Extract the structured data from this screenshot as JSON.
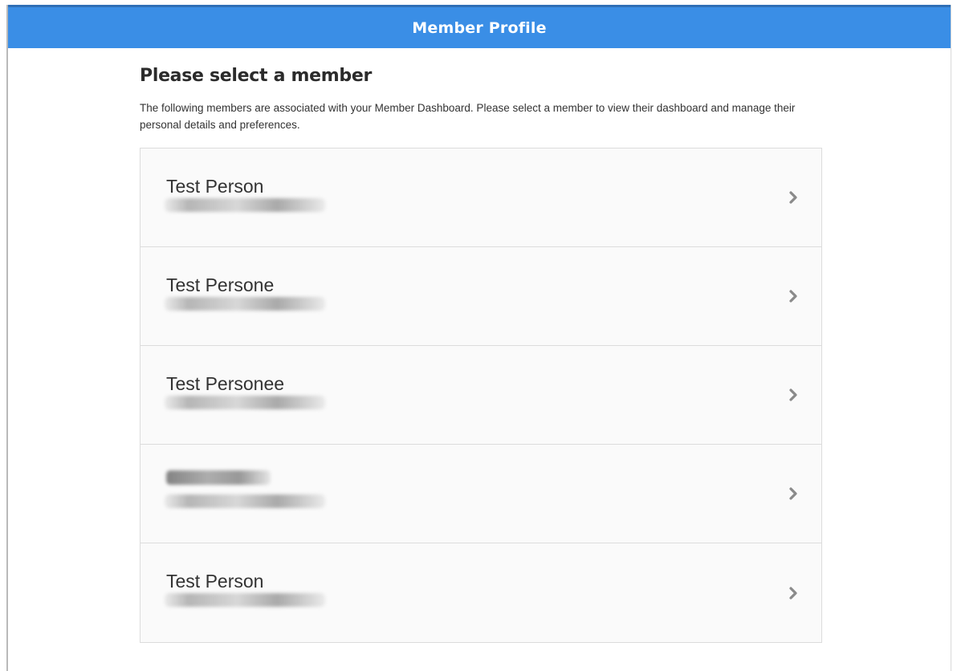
{
  "header": {
    "title": "Member Profile"
  },
  "main": {
    "heading": "Please select a member",
    "intro": "The following members are associated with your Member Dashboard. Please select a member to view their dashboard and manage their personal details and preferences."
  },
  "members": [
    {
      "name": "Test Person",
      "name_redacted": false,
      "detail_redacted": true
    },
    {
      "name": "Test Persone",
      "name_redacted": false,
      "detail_redacted": true
    },
    {
      "name": "Test Personee",
      "name_redacted": false,
      "detail_redacted": true
    },
    {
      "name": "",
      "name_redacted": true,
      "detail_redacted": true
    },
    {
      "name": "Test Person",
      "name_redacted": false,
      "detail_redacted": true
    }
  ],
  "icons": {
    "row_action": "chevron-right-icon"
  },
  "colors": {
    "header_bg": "#3a8ee6",
    "header_text": "#ffffff",
    "list_bg": "#fafafa",
    "chevron": "#8a8a8a"
  }
}
